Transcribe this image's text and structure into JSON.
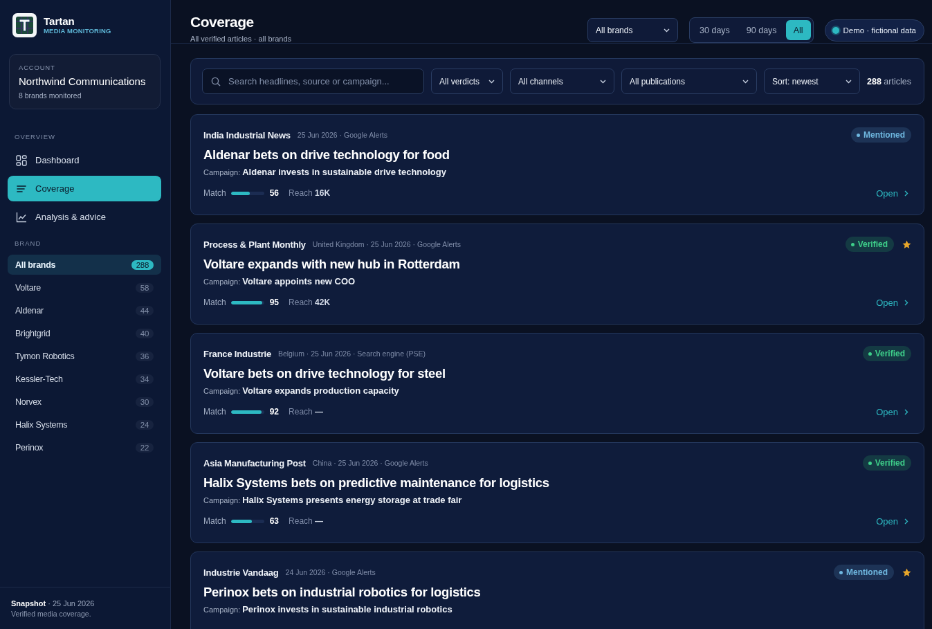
{
  "brand": {
    "name": "Tartan",
    "tagline": "MEDIA MONITORING"
  },
  "account": {
    "label": "ACCOUNT",
    "name": "Northwind Communications",
    "detail": "8 brands monitored"
  },
  "nav": {
    "heading": "OVERVIEW",
    "items": [
      {
        "label": "Dashboard",
        "kind": "grid",
        "selected": false
      },
      {
        "label": "Coverage",
        "kind": "list",
        "selected": true
      },
      {
        "label": "Analysis & advice",
        "kind": "chart",
        "selected": false
      }
    ]
  },
  "brands": {
    "heading": "BRAND",
    "items": [
      {
        "label": "All brands",
        "count": "288",
        "selected": true
      },
      {
        "label": "Voltare",
        "count": "58",
        "selected": false
      },
      {
        "label": "Aldenar",
        "count": "44",
        "selected": false
      },
      {
        "label": "Brightgrid",
        "count": "40",
        "selected": false
      },
      {
        "label": "Tymon Robotics",
        "count": "36",
        "selected": false
      },
      {
        "label": "Kessler-Tech",
        "count": "34",
        "selected": false
      },
      {
        "label": "Norvex",
        "count": "30",
        "selected": false
      },
      {
        "label": "Halix Systems",
        "count": "24",
        "selected": false
      },
      {
        "label": "Perinox",
        "count": "22",
        "selected": false
      }
    ]
  },
  "footer": {
    "snapshot": "**Snapshot** · 25 Jun 2026",
    "note": "Verified media coverage."
  },
  "header": {
    "title": "Coverage",
    "subtitle": "All verified articles · all brands",
    "brand_select": "All brands",
    "ranges": [
      {
        "label": "30 days",
        "selected": false
      },
      {
        "label": "90 days",
        "selected": false
      },
      {
        "label": "All",
        "selected": true
      }
    ],
    "demo_badge": "Demo · fictional data"
  },
  "filters": {
    "search_placeholder": "Search headlines, source or campaign...",
    "selects": [
      "All verdicts",
      "All channels",
      "All publications",
      "Sort: newest"
    ],
    "count": "**288** articles"
  },
  "articles": [
    {
      "source": "India Industrial News",
      "meta": "25 Jun 2026 · Google Alerts",
      "verdict": {
        "label": "Mentioned",
        "kind": "mentioned"
      },
      "starred": false,
      "headline": "Aldenar bets on drive technology for food",
      "campaign_label": "Campaign:",
      "campaign": "Aldenar invests in sustainable drive technology",
      "match_label": "Match",
      "level": 0.56,
      "score": "56",
      "reach_label": "Reach",
      "reach": "16K",
      "open": "Open"
    },
    {
      "source": "Process & Plant Monthly",
      "meta": "United Kingdom · 25 Jun 2026 · Google Alerts",
      "verdict": {
        "label": "Verified",
        "kind": "verified"
      },
      "starred": true,
      "headline": "Voltare expands with new hub in Rotterdam",
      "campaign_label": "Campaign:",
      "campaign": "Voltare appoints new COO",
      "match_label": "Match",
      "level": 0.95,
      "score": "95",
      "reach_label": "Reach",
      "reach": "42K",
      "open": "Open"
    },
    {
      "source": "France Industrie",
      "meta": "Belgium · 25 Jun 2026 · Search engine (PSE)",
      "verdict": {
        "label": "Verified",
        "kind": "verified"
      },
      "starred": false,
      "headline": "Voltare bets on drive technology for steel",
      "campaign_label": "Campaign:",
      "campaign": "Voltare expands production capacity",
      "match_label": "Match",
      "level": 0.92,
      "score": "92",
      "reach_label": "Reach",
      "reach": "—",
      "open": "Open"
    },
    {
      "source": "Asia Manufacturing Post",
      "meta": "China · 25 Jun 2026 · Google Alerts",
      "verdict": {
        "label": "Verified",
        "kind": "verified"
      },
      "starred": false,
      "headline": "Halix Systems bets on predictive maintenance for logistics",
      "campaign_label": "Campaign:",
      "campaign": "Halix Systems presents energy storage at trade fair",
      "match_label": "Match",
      "level": 0.63,
      "score": "63",
      "reach_label": "Reach",
      "reach": "—",
      "open": "Open"
    },
    {
      "source": "Industrie Vandaag",
      "meta": "24 Jun 2026 · Google Alerts",
      "verdict": {
        "label": "Mentioned",
        "kind": "mentioned"
      },
      "starred": true,
      "headline": "Perinox bets on industrial robotics for logistics",
      "campaign_label": "Campaign:",
      "campaign": "Perinox invests in sustainable industrial robotics"
    }
  ]
}
